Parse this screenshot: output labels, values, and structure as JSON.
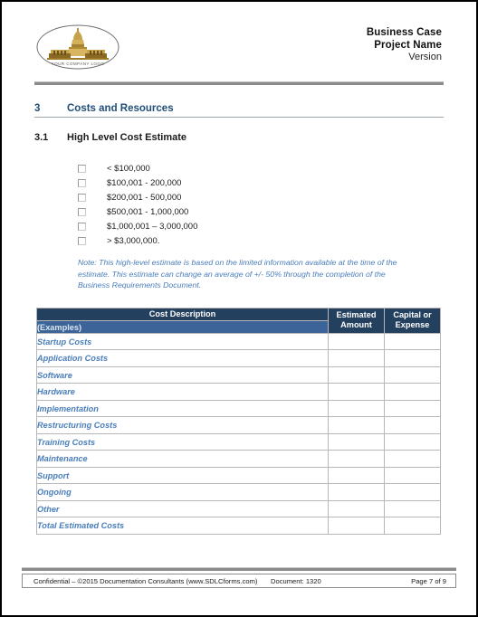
{
  "header": {
    "logo_alt": "YOUR COMPANY LOGO",
    "logo_caption": "YOUR COMPANY LOGO",
    "title_line1": "Business Case",
    "title_line2": "Project  Name",
    "title_line3": "Version"
  },
  "section": {
    "number": "3",
    "title": "Costs and Resources"
  },
  "subsection": {
    "number": "3.1",
    "title": "High Level Cost Estimate"
  },
  "checkboxes": [
    {
      "label": "< $100,000",
      "checked": false
    },
    {
      "label": "$100,001 - 200,000",
      "checked": false
    },
    {
      "label": "$200,001 - 500,000",
      "checked": false
    },
    {
      "label": "$500,001 - 1,000,000",
      "checked": false
    },
    {
      "label": "$1,000,001 – 3,000,000",
      "checked": false
    },
    {
      "label": "> $3,000,000.",
      "checked": false
    }
  ],
  "note": "Note: This high-level estimate is based on the limited information available at the time of the estimate. This estimate can change an average of +/- 50% through the completion of the Business Requirements Document.",
  "table": {
    "headers": {
      "cost_description": "Cost Description",
      "examples": "(Examples)",
      "estimated_amount": "Estimated Amount",
      "capital_or_expense": "Capital or Expense"
    },
    "rows": [
      {
        "description": "Startup Costs",
        "estimated_amount": "",
        "capital_or_expense": ""
      },
      {
        "description": "Application Costs",
        "estimated_amount": "",
        "capital_or_expense": ""
      },
      {
        "description": "Software",
        "estimated_amount": "",
        "capital_or_expense": ""
      },
      {
        "description": "Hardware",
        "estimated_amount": "",
        "capital_or_expense": ""
      },
      {
        "description": "Implementation",
        "estimated_amount": "",
        "capital_or_expense": ""
      },
      {
        "description": "Restructuring Costs",
        "estimated_amount": "",
        "capital_or_expense": ""
      },
      {
        "description": "Training Costs",
        "estimated_amount": "",
        "capital_or_expense": ""
      },
      {
        "description": "Maintenance",
        "estimated_amount": "",
        "capital_or_expense": ""
      },
      {
        "description": "Support",
        "estimated_amount": "",
        "capital_or_expense": ""
      },
      {
        "description": "Ongoing",
        "estimated_amount": "",
        "capital_or_expense": ""
      },
      {
        "description": "Other",
        "estimated_amount": "",
        "capital_or_expense": ""
      },
      {
        "description": "Total Estimated Costs",
        "estimated_amount": "",
        "capital_or_expense": ""
      }
    ]
  },
  "footer": {
    "confidential": "Confidential – ©2015 Documentation Consultants (www.SDLCforms.com)",
    "document": "Document: 1320",
    "page": "Page 7 of 9"
  },
  "colors": {
    "heading_blue": "#1f4e79",
    "accent_blue": "#4a7ebb",
    "table_header_dark": "#24405f",
    "table_header_light": "#3c6499",
    "rule_gray": "#8b8b8b"
  }
}
